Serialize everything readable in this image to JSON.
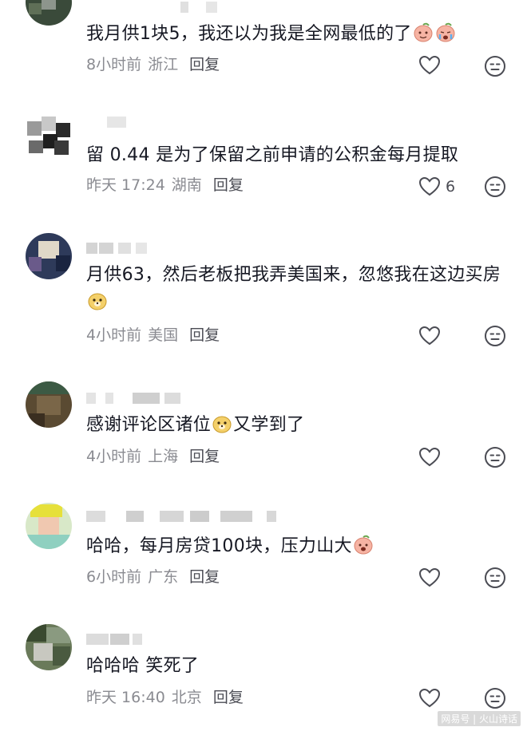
{
  "comments": [
    {
      "text_before": "我月供1块5，我还以为我是全网最低的了",
      "emojis": [
        "peach-face-emoji",
        "crying-face-emoji"
      ],
      "text_after": "",
      "time": "8小时前",
      "location": "浙江",
      "reply_label": "回复",
      "like_count": ""
    },
    {
      "text_before": "留 0.44 是为了保留之前申请的公积金每月提取",
      "emojis": [],
      "text_after": "",
      "time": "昨天 17:24",
      "location": "湖南",
      "reply_label": "回复",
      "like_count": "6"
    },
    {
      "text_before": "月供63，然后老板把我弄美国来，忽悠我在这边买房",
      "emojis": [
        "dog-face-emoji"
      ],
      "text_after": "",
      "time": "4小时前",
      "location": "美国",
      "reply_label": "回复",
      "like_count": ""
    },
    {
      "text_before": "感谢评论区诸位",
      "emojis": [
        "dog-face-emoji"
      ],
      "text_after": "又学到了",
      "time": "4小时前",
      "location": "上海",
      "reply_label": "回复",
      "like_count": ""
    },
    {
      "text_before": "哈哈，每月房贷100块，压力山大",
      "emojis": [
        "peach-face-emoji"
      ],
      "text_after": "",
      "time": "6小时前",
      "location": "广东",
      "reply_label": "回复",
      "like_count": ""
    },
    {
      "text_before": "哈哈哈 笑死了",
      "emojis": [],
      "text_after": "",
      "time": "昨天 16:40",
      "location": "北京",
      "reply_label": "回复",
      "like_count": ""
    }
  ],
  "watermark": "网易号 | 火山诗话",
  "colors": {
    "text": "#161823",
    "meta": "#8a8b91",
    "reply": "#4b4c54",
    "icon": "#4b4c54"
  }
}
